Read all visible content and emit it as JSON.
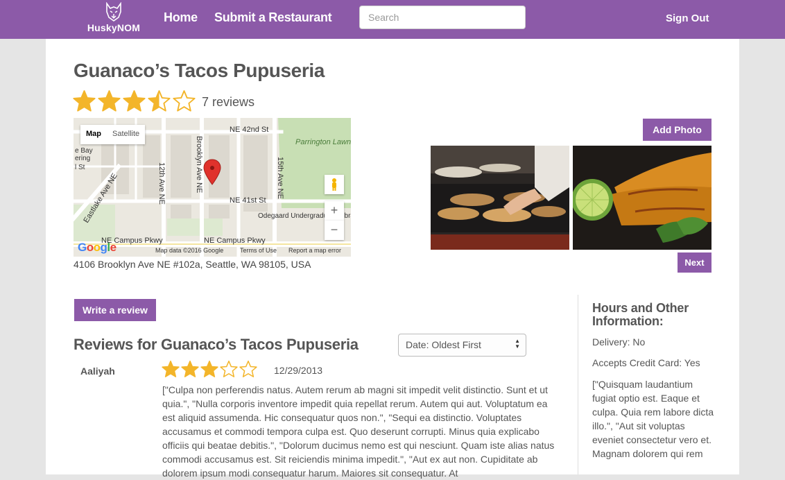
{
  "nav": {
    "logo_text": "HuskyNOM",
    "home": "Home",
    "submit": "Submit a Restaurant",
    "search_placeholder": "Search",
    "sign_out": "Sign Out"
  },
  "restaurant": {
    "name": "Guanaco’s Tacos Pupuseria",
    "rating": 3.5,
    "review_count": "7 reviews",
    "address": "4106 Brooklyn Ave NE #102a, Seattle, WA 98105, USA"
  },
  "map": {
    "type_map": "Map",
    "type_satellite": "Satellite",
    "streets": [
      "NE 42nd St",
      "NE 41st St",
      "NE Campus Pkwy",
      "NE Campus Pkwy",
      "Brooklyn Ave NE",
      "12th Ave NE",
      "15th Ave NE",
      "Eastlake Ave NE"
    ],
    "places": [
      "Parrington Lawn",
      "Odegaard Undergraduate Library (OUG",
      "e Bay",
      "ering",
      "l St"
    ],
    "zoom_in": "+",
    "zoom_out": "−",
    "google": "Google",
    "map_data": "Map data ©2016 Google",
    "terms": "Terms of Use",
    "report": "Report a map error"
  },
  "photos": {
    "add_label": "Add Photo",
    "next_label": "Next"
  },
  "reviews": {
    "write_label": "Write a review",
    "heading": "Reviews for Guanaco’s Tacos Pupuseria",
    "sort_selected": "Date: Oldest First",
    "items": [
      {
        "author": "Aaliyah",
        "rating": 3,
        "date": "12/29/2013",
        "text": "[\"Culpa non perferendis natus. Autem rerum ab magni sit impedit velit distinctio. Sunt et ut quia.\", \"Nulla corporis inventore impedit quia repellat rerum. Autem qui aut. Voluptatum ea est aliquid assumenda. Hic consequatur quos non.\", \"Sequi ea distinctio. Voluptates accusamus et commodi tempora culpa est. Quo deserunt corrupti. Minus quia explicabo officiis qui beatae debitis.\", \"Dolorum ducimus nemo est qui nesciunt. Quam iste alias natus commodi accusamus est. Sit reiciendis minima impedit.\", \"Aut ex aut non. Cupiditate ab dolorem ipsum modi consequatur harum. Maiores sit consequatur. At"
      }
    ]
  },
  "sidebar": {
    "title": "Hours and Other Information:",
    "delivery": "Delivery: No",
    "credit": "Accepts Credit Card: Yes",
    "description": "[\"Quisquam laudantium fugiat optio est. Eaque et culpa. Quia rem labore dicta illo.\", \"Aut sit voluptas eveniet consectetur vero et. Magnam dolorem qui rem"
  },
  "colors": {
    "brand": "#8c5aa8",
    "star": "#f3b52a"
  }
}
